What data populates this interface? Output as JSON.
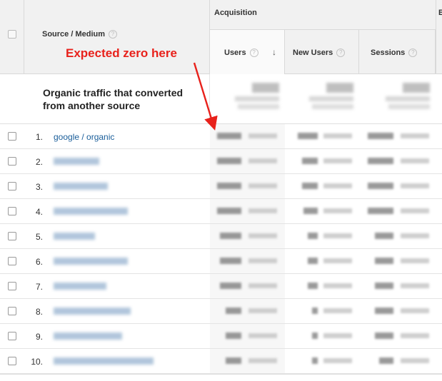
{
  "header": {
    "source_medium_label": "Source / Medium",
    "group_label": "Acquisition",
    "next_group_letter": "B",
    "columns": [
      {
        "label": "Users",
        "sorted": true
      },
      {
        "label": "New Users"
      },
      {
        "label": "Sessions"
      }
    ],
    "help_glyph": "?",
    "sort_glyph": "↓"
  },
  "summary": {
    "label": "Organic traffic that converted from another source"
  },
  "rows": [
    {
      "num": "1.",
      "source": "google / organic"
    },
    {
      "num": "2.",
      "source": ""
    },
    {
      "num": "3.",
      "source": ""
    },
    {
      "num": "4.",
      "source": ""
    },
    {
      "num": "5.",
      "source": ""
    },
    {
      "num": "6.",
      "source": ""
    },
    {
      "num": "7.",
      "source": ""
    },
    {
      "num": "8.",
      "source": ""
    },
    {
      "num": "9.",
      "source": ""
    },
    {
      "num": "10.",
      "source": ""
    }
  ],
  "annotation": {
    "text": "Expected zero here",
    "color": "#e8211b"
  },
  "colors": {
    "link": "#1a5e9a",
    "header_bg": "#f1f1f1"
  }
}
